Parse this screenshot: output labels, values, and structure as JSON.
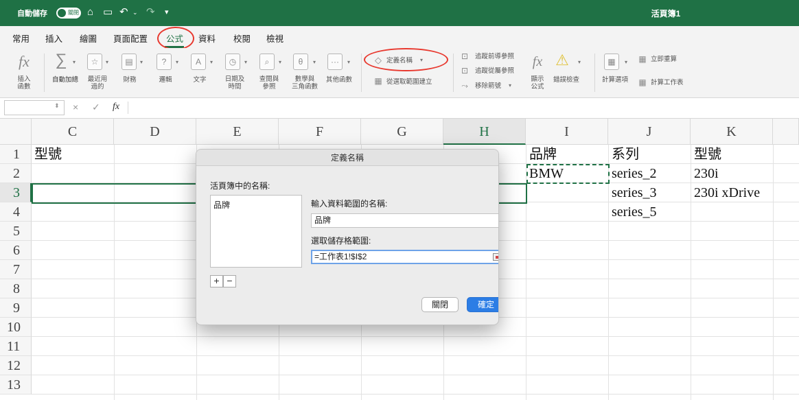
{
  "titlebar": {
    "autosave_label": "自動儲存",
    "autosave_state": "關閉",
    "home_icon": "home-icon",
    "save_icon": "save-icon",
    "undo_icon": "undo-icon",
    "redo_icon": "redo-icon",
    "customize_icon": "customize-toolbar-icon",
    "document_title": "活頁簿1",
    "bar_color": "#1f7145"
  },
  "tabs": [
    "常用",
    "插入",
    "繪圖",
    "頁面配置",
    "公式",
    "資料",
    "校閱",
    "檢視"
  ],
  "active_tab": "公式",
  "ribbon": {
    "insert_function": "插入\n函數",
    "autosum": "自動加總",
    "recent": "最近用\n過的",
    "financial": "財務",
    "logical": "邏輯",
    "text": "文字",
    "datetime": "日期及\n時間",
    "lookup": "查閱與\n參照",
    "math": "數學與\n三角函數",
    "more": "其他函數",
    "define_name": "定義名稱",
    "create_from_selection": "從選取範圍建立",
    "trace_precedents": "追蹤前導參照",
    "trace_dependents": "追蹤從屬參照",
    "remove_arrows": "移除箭號",
    "show_formulas": "顯示\n公式",
    "error_checking": "錯誤檢查",
    "calc_options": "計算選項",
    "calc_now": "立即重算",
    "calc_sheet": "計算工作表"
  },
  "formula_bar": {
    "name_box": "",
    "fx_label": "fx",
    "cancel_symbol": "×",
    "enter_symbol": "✓"
  },
  "grid": {
    "columns": [
      "C",
      "D",
      "E",
      "F",
      "G",
      "H",
      "I",
      "J",
      "K"
    ],
    "selected_column": "H",
    "rows": [
      "1",
      "2",
      "3",
      "4",
      "5",
      "6",
      "7",
      "8",
      "9",
      "10",
      "11",
      "12",
      "13"
    ],
    "selected_row": "3",
    "cells": {
      "C1": "型號",
      "I1": "品牌",
      "I2": "BMW",
      "J1": "系列",
      "J2": "series_2",
      "J3": "series_3",
      "J4": "series_5",
      "K1": "型號",
      "K2": "230i",
      "K3": "230i xDrive"
    }
  },
  "dialog": {
    "title": "定義名稱",
    "names_label": "活頁簿中的名稱:",
    "names_list": [
      "品牌"
    ],
    "add_symbol": "+",
    "remove_symbol": "−",
    "name_field_label": "輸入資料範圍的名稱:",
    "name_field_value": "品牌",
    "range_field_label": "選取儲存格範圍:",
    "range_field_value": "=工作表1!$I$2",
    "close_button": "關閉",
    "ok_button": "確定",
    "ok_color": "#2c7de5"
  },
  "annotation_color": "#e8392f"
}
